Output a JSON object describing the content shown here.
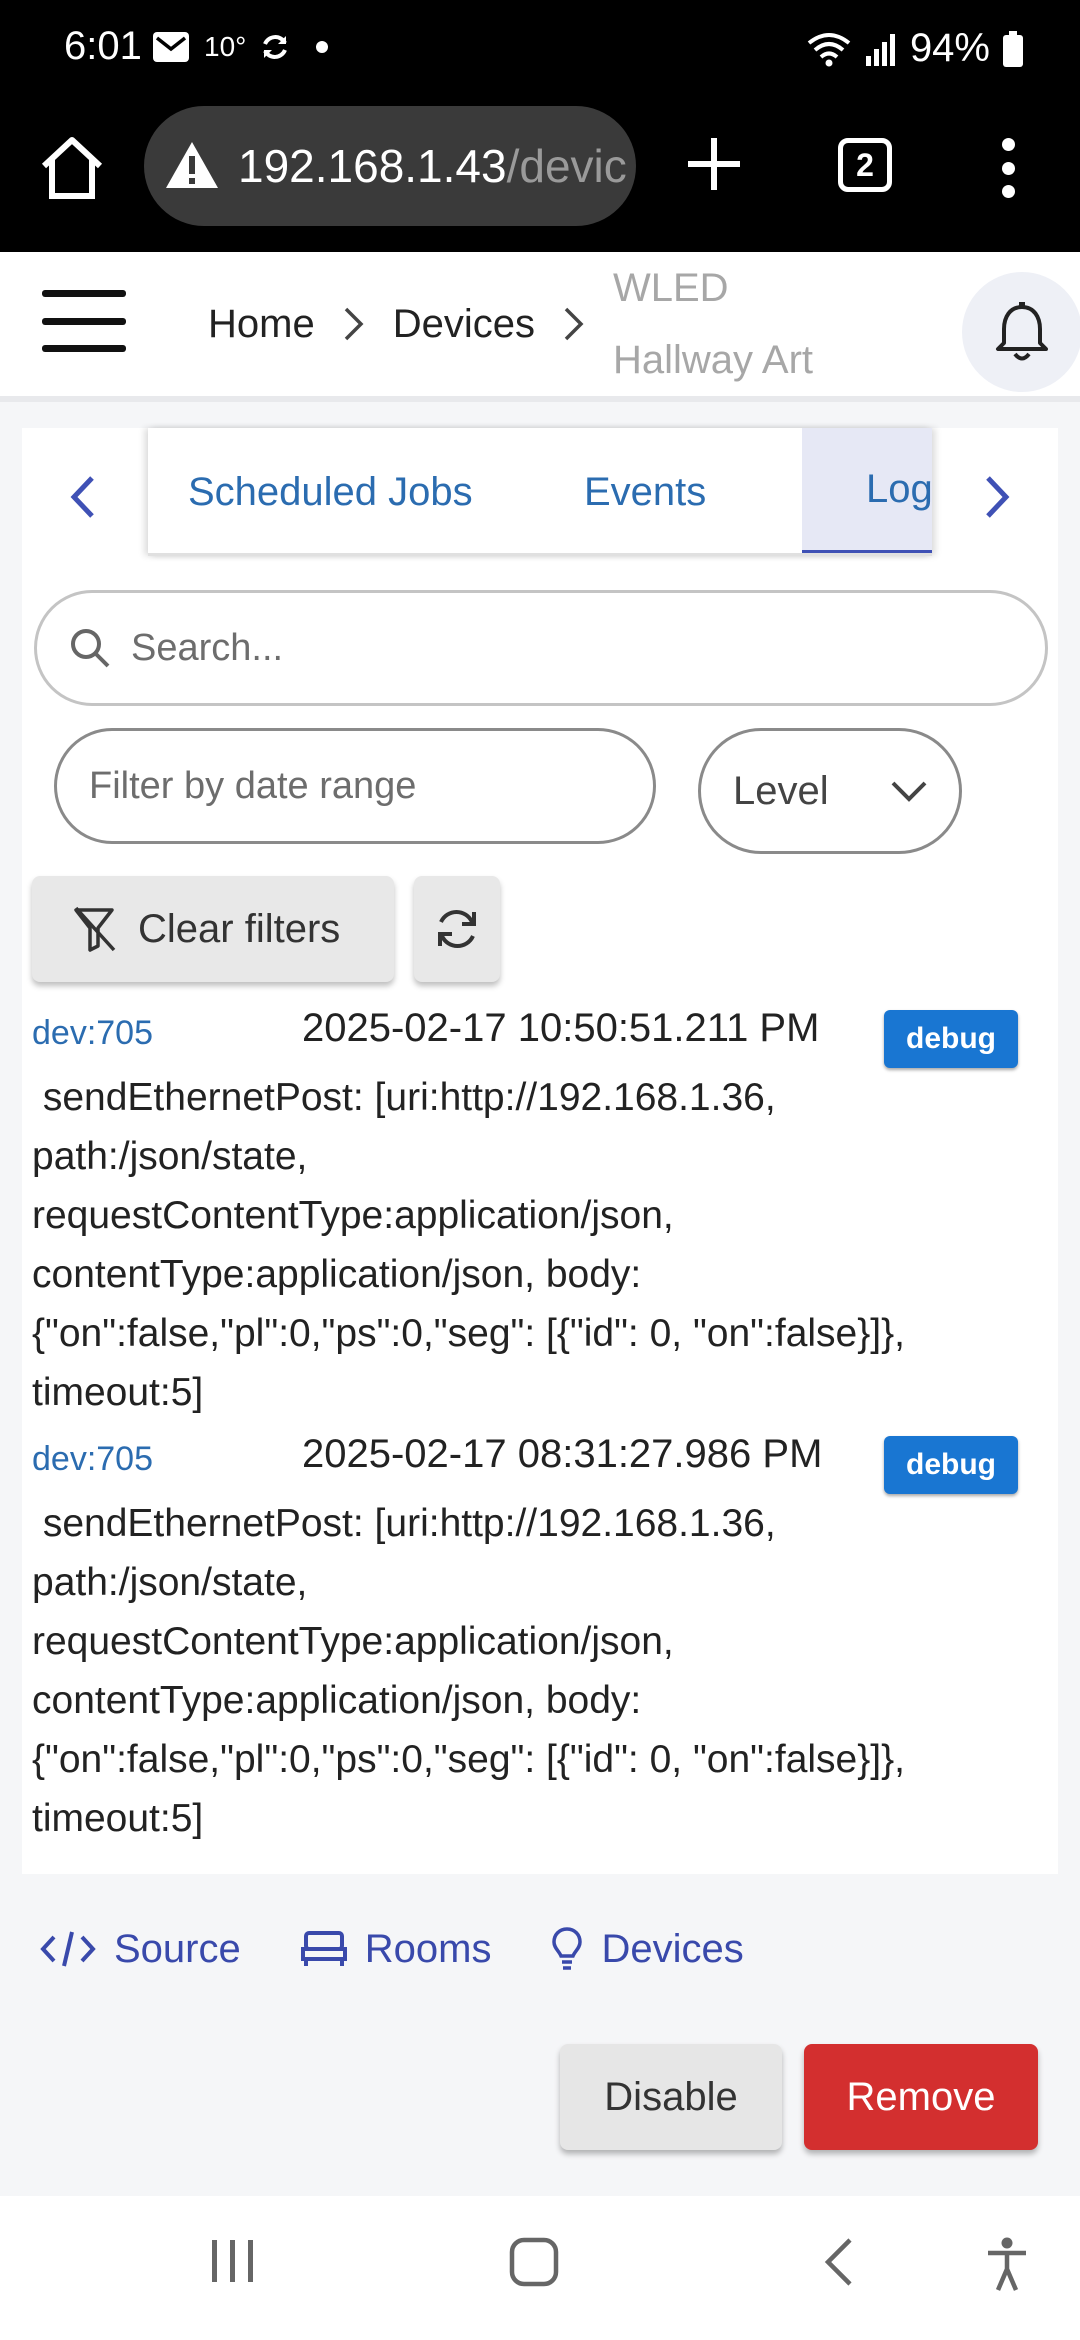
{
  "status_bar": {
    "time": "6:01",
    "temperature": "10°",
    "battery": "94%",
    "icons": [
      "mail-icon",
      "sync-icon",
      "wifi-icon",
      "signal-icon",
      "battery-icon"
    ]
  },
  "browser": {
    "url_host": "192.168.1.43",
    "url_path": "/devic",
    "tab_count": "2",
    "icons": [
      "home-icon",
      "warning-icon",
      "plus-icon",
      "tabs-icon",
      "more-vert-icon"
    ]
  },
  "header": {
    "breadcrumbs": [
      "Home",
      "Devices"
    ],
    "current_line1": "WLED",
    "current_line2": "Hallway Art",
    "icons": [
      "menu-icon",
      "chevron-right-icon",
      "bell-icon"
    ]
  },
  "tabs": {
    "items": [
      "Scheduled Jobs",
      "Events",
      "Log"
    ],
    "active": "Log"
  },
  "filters": {
    "search_placeholder": "Search...",
    "date_placeholder": "Filter by date range",
    "level_label": "Level",
    "clear_label": "Clear filters"
  },
  "logs": [
    {
      "source": "dev:705",
      "time": "2025-02-17 10:50:51.211 PM",
      "level": "debug",
      "message": " sendEthernetPost: [uri:http://192.168.1.36,\npath:/json/state,\nrequestContentType:application/json,\ncontentType:application/json, body:\n{\"on\":false,\"pl\":0,\"ps\":0,\"seg\": [{\"id\": 0, \"on\":false}]},\ntimeout:5]"
    },
    {
      "source": "dev:705",
      "time": "2025-02-17 08:31:27.986 PM",
      "level": "debug",
      "message": " sendEthernetPost: [uri:http://192.168.1.36,\npath:/json/state,\nrequestContentType:application/json,\ncontentType:application/json, body:\n{\"on\":false,\"pl\":0,\"ps\":0,\"seg\": [{\"id\": 0, \"on\":false}]},\ntimeout:5]"
    }
  ],
  "footer": {
    "links": [
      "Source",
      "Rooms",
      "Devices"
    ],
    "disable_label": "Disable",
    "remove_label": "Remove"
  },
  "colors": {
    "primary": "#3f51b5",
    "link": "#2b6cb0",
    "debug_badge": "#1976d2",
    "danger": "#d32f2f"
  }
}
